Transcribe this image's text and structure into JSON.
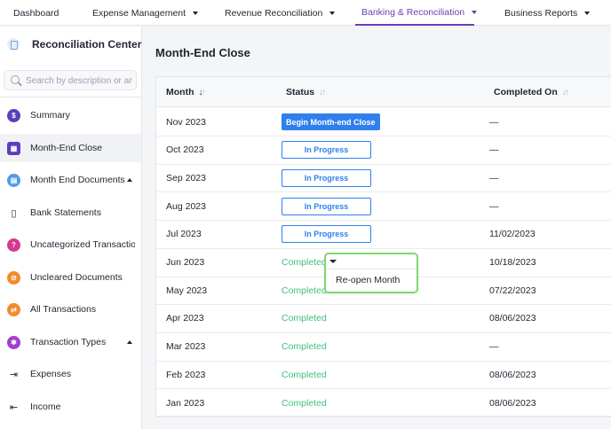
{
  "topnav": {
    "items": [
      {
        "label": "Dashboard"
      },
      {
        "label": "Expense Management"
      },
      {
        "label": "Revenue Reconciliation"
      },
      {
        "label": "Banking & Reconciliation"
      },
      {
        "label": "Business Reports"
      }
    ],
    "active_index": 3,
    "accent_color": "#6a3fb5"
  },
  "sidebar": {
    "title": "Reconciliation Center",
    "search_placeholder": "Search by description or amount",
    "items": [
      {
        "label": "Summary",
        "icon": "summary-icon",
        "color": "#5b3fbf"
      },
      {
        "label": "Month-End Close",
        "icon": "calendar-icon",
        "color": "#5b3fbf"
      },
      {
        "label": "Month End Documents",
        "icon": "documents-icon",
        "color": "#4f9de6"
      },
      {
        "label": "Bank Statements",
        "icon": "bank-statement-icon",
        "color": ""
      },
      {
        "label": "Uncategorized Transactions",
        "icon": "question-icon",
        "color": "#d6398f"
      },
      {
        "label": "Uncleared Documents",
        "icon": "uncleared-icon",
        "color": "#f08c2e"
      },
      {
        "label": "All Transactions",
        "icon": "transactions-icon",
        "color": "#f08c2e"
      },
      {
        "label": "Transaction Types",
        "icon": "types-icon",
        "color": "#a23fd0"
      },
      {
        "label": "Expenses",
        "icon": "expenses-icon",
        "color": ""
      },
      {
        "label": "Income",
        "icon": "income-icon",
        "color": ""
      }
    ]
  },
  "main": {
    "title": "Month-End Close",
    "columns": {
      "month": "Month",
      "status": "Status",
      "completed_on": "Completed On"
    },
    "rows": [
      {
        "month": "Nov 2023",
        "status": "Begin Month-end Close",
        "status_type": "primary-button",
        "completed_on": "—"
      },
      {
        "month": "Oct 2023",
        "status": "In Progress",
        "status_type": "outline-button",
        "completed_on": "—"
      },
      {
        "month": "Sep 2023",
        "status": "In Progress",
        "status_type": "outline-button",
        "completed_on": "—"
      },
      {
        "month": "Aug 2023",
        "status": "In Progress",
        "status_type": "outline-button",
        "completed_on": "—"
      },
      {
        "month": "Jul 2023",
        "status": "In Progress",
        "status_type": "outline-button",
        "completed_on": "11/02/2023"
      },
      {
        "month": "Jun 2023",
        "status": "Completed",
        "status_type": "text",
        "completed_on": "10/18/2023"
      },
      {
        "month": "May 2023",
        "status": "Completed",
        "status_type": "text",
        "completed_on": "07/22/2023"
      },
      {
        "month": "Apr 2023",
        "status": "Completed",
        "status_type": "text",
        "completed_on": "08/06/2023"
      },
      {
        "month": "Mar 2023",
        "status": "Completed",
        "status_type": "text",
        "completed_on": "—"
      },
      {
        "month": "Feb 2023",
        "status": "Completed",
        "status_type": "text",
        "completed_on": "08/06/2023"
      },
      {
        "month": "Jan 2023",
        "status": "Completed",
        "status_type": "text",
        "completed_on": "08/06/2023"
      }
    ],
    "popup": {
      "item": "Re-open Month"
    },
    "colors": {
      "primary": "#2f80ed",
      "completed": "#3fbf7f",
      "popup_border": "#7fd96b"
    }
  }
}
